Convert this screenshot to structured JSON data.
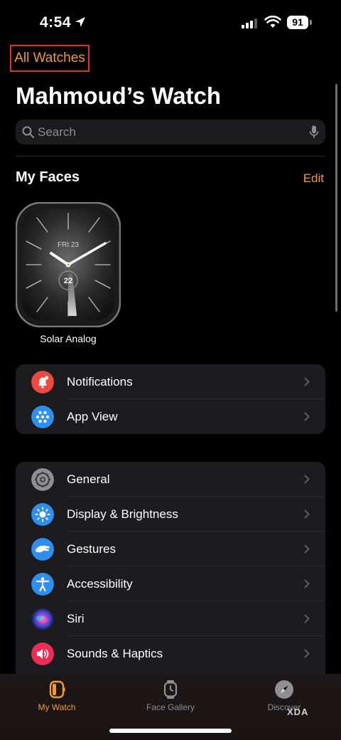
{
  "status_bar": {
    "time": "4:54",
    "battery": "91"
  },
  "nav": {
    "all_watches": "All Watches"
  },
  "header": {
    "title": "Mahmoud’s Watch"
  },
  "search": {
    "placeholder": "Search"
  },
  "my_faces": {
    "section_title": "My Faces",
    "edit_label": "Edit",
    "faces": [
      {
        "name": "Solar Analog",
        "date": "FRI 23",
        "complication": "22"
      }
    ]
  },
  "group1": [
    {
      "label": "Notifications",
      "icon": "bell-icon",
      "color": "#f0473e"
    },
    {
      "label": "App View",
      "icon": "grid-dots-icon",
      "color": "#2f8ff0"
    }
  ],
  "group2": [
    {
      "label": "General",
      "icon": "gear-icon",
      "color": "#8e8e93"
    },
    {
      "label": "Display & Brightness",
      "icon": "sun-icon",
      "color": "#2f8ff0"
    },
    {
      "label": "Gestures",
      "icon": "hand-icon",
      "color": "#2f8ff0"
    },
    {
      "label": "Accessibility",
      "icon": "accessibility-icon",
      "color": "#2f8ff0"
    },
    {
      "label": "Siri",
      "icon": "siri-icon",
      "color": "#6b3fd1"
    },
    {
      "label": "Sounds & Haptics",
      "icon": "speaker-icon",
      "color": "#ee2d55"
    }
  ],
  "tabs": [
    {
      "label": "My Watch",
      "icon": "watch-active-icon",
      "active": true
    },
    {
      "label": "Face Gallery",
      "icon": "watch-icon",
      "active": false
    },
    {
      "label": "Discover",
      "icon": "compass-icon",
      "active": false
    }
  ],
  "watermark": "XDA",
  "colors": {
    "accent": "#f19a37",
    "highlight_box": "#e4311f",
    "cell_bg": "#1c1c1e"
  }
}
